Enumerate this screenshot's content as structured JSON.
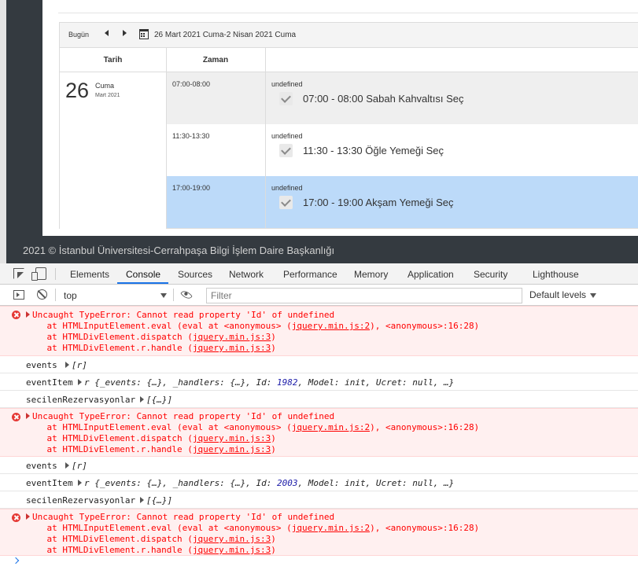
{
  "calendar": {
    "today_button": "Bugün",
    "date_range": "26 Mart 2021 Cuma-2 Nisan 2021 Cuma",
    "headers": {
      "date": "Tarih",
      "time": "Zaman"
    },
    "day_number": "26",
    "day_name": "Cuma",
    "month_year": "Mart 2021",
    "slots": [
      {
        "time": "07:00-08:00",
        "status": "undefined",
        "label": "07:00 - 08:00 Sabah Kahvaltısı Seç",
        "bg": "#efefef"
      },
      {
        "time": "11:30-13:30",
        "status": "undefined",
        "label": "11:30 - 13:30 Öğle Yemeği Seç",
        "bg": "#ffffff"
      },
      {
        "time": "17:00-19:00",
        "status": "undefined",
        "label": "17:00 - 19:00 Akşam Yemeği Seç",
        "bg": "#bcdaf9"
      }
    ]
  },
  "footer": {
    "text": "2021 © İstanbul Üniversitesi-Cerrahpaşa Bilgi İşlem Daire Başkanlığı"
  },
  "devtools": {
    "tabs": [
      "Elements",
      "Console",
      "Sources",
      "Network",
      "Performance",
      "Memory",
      "Application",
      "Security",
      "Lighthouse"
    ],
    "active_tab": "Console",
    "context": "top",
    "filter_placeholder": "Filter",
    "levels": "Default levels",
    "error": {
      "message": "Uncaught TypeError: Cannot read property 'Id' of undefined",
      "frame1_prefix": "    at HTMLInputElement.eval (eval at <anonymous> (",
      "frame1_link": "jquery.min.js:2",
      "frame1_suffix": "), <anonymous>:16:28)",
      "frame2_prefix": "    at HTMLDivElement.dispatch (",
      "frame2_link": "jquery.min.js:3",
      "frame2_suffix": ")",
      "frame3_prefix": "    at HTMLDivElement.r.handle (",
      "frame3_link": "jquery.min.js:3",
      "frame3_suffix": ")"
    },
    "logs": [
      {
        "events_label": "events",
        "events_value": "[r]",
        "item_label": "eventItem",
        "item_prefix": "r {_events: {…}, _handlers: {…}, Id: ",
        "item_id": "1982",
        "item_suffix": ", Model: init, Ucret: null, …}",
        "sel_label": "secilenRezervasyonlar",
        "sel_value": "[{…}]"
      },
      {
        "events_label": "events",
        "events_value": "[r]",
        "item_label": "eventItem",
        "item_prefix": "r {_events: {…}, _handlers: {…}, Id: ",
        "item_id": "2003",
        "item_suffix": ", Model: init, Ucret: null, …}",
        "sel_label": "secilenRezervasyonlar",
        "sel_value": "[{…}]"
      }
    ]
  },
  "colors": {
    "page_dark": "#343a40",
    "selected_slot": "#bcdaf9",
    "error_bg": "#fff0f0",
    "error_text": "#ff0000",
    "active_tab_underline": "#1a73e8"
  }
}
